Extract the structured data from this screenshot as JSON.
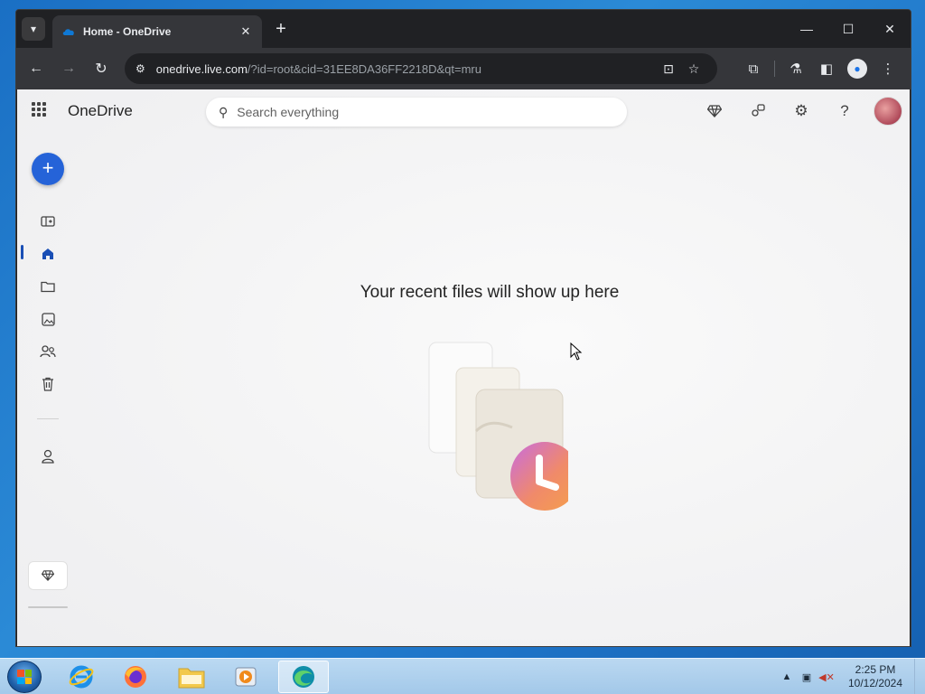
{
  "browser": {
    "tab_title": "Home - OneDrive",
    "tab_close": "✕",
    "new_tab": "+",
    "window_controls": {
      "minimize": "—",
      "maximize": "☐",
      "close": "✕"
    },
    "url_host": "onedrive.live.com",
    "url_rest": "/?id=root&cid=31EE8DA36FF2218D&qt=mru",
    "colors": {
      "frame": "#202124",
      "toolbar": "#35363a"
    }
  },
  "app": {
    "name": "OneDrive",
    "search_placeholder": "Search everything",
    "header_icons": [
      "premium-diamond-icon",
      "share-icon",
      "settings-gear-icon",
      "help-icon"
    ],
    "help_label": "?"
  },
  "rail": {
    "create_label": "+",
    "items": [
      "toggle-pane",
      "home",
      "my-files",
      "photos",
      "shared",
      "recycle-bin",
      "people"
    ],
    "active": "home"
  },
  "main": {
    "empty_title": "Your recent files will show up here"
  },
  "taskbar": {
    "apps": [
      "internet-explorer",
      "firefox",
      "file-explorer",
      "media-player",
      "edge"
    ],
    "active_app": "edge",
    "time": "2:25 PM",
    "date": "10/12/2024"
  }
}
